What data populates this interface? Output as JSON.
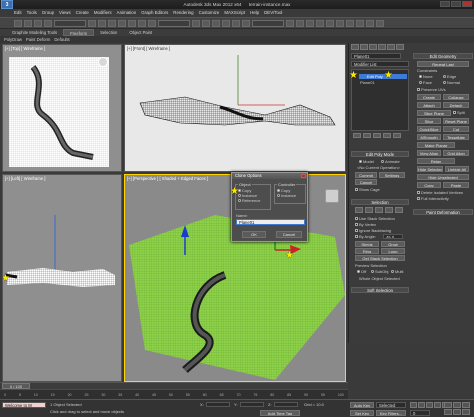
{
  "app": {
    "title": "Autodesk 3ds Max 2012 x64",
    "file": "terrain-instance.max",
    "logo_text": "3"
  },
  "menu": [
    "Edit",
    "Tools",
    "Group",
    "Views",
    "Create",
    "Modifiers",
    "Animation",
    "Graph Editors",
    "Rendering",
    "Customize",
    "MAXScript",
    "Help",
    "DEV/Tool"
  ],
  "ribbon": {
    "title_left": "Graphite Modeling Tools",
    "tabs": [
      "Freeform",
      "Selection",
      "Object Paint"
    ],
    "active_tab": "Freeform",
    "sub": [
      "PolyDraw",
      "Paint Deform",
      "Defaults"
    ]
  },
  "viewports": {
    "top": "[+] [Top] [ Wireframe ]",
    "front": "[+] [Front] [ Wireframe ]",
    "left": "[+] [Left] [ Wireframe ]",
    "perspective": "[+] [Perspective ] [ Shaded + Edged Faces ]"
  },
  "command_panel": {
    "object_name": "Plane01",
    "modifier_list": "Modifier List",
    "stack": [
      "Edit Poly",
      "Vertex",
      "Edge",
      "Border",
      "Polygon",
      "Element",
      "Plane01",
      "Edit Poly"
    ],
    "stack_selected": "Edit Poly",
    "rollouts": {
      "edit_poly_mode": "Edit Poly Mode",
      "model": "Model",
      "animate": "Animate",
      "no_current": "<No Current Operation>",
      "commit": "Commit",
      "settings": "Settings",
      "cancel": "Cancel",
      "show_cage": "Show Cage",
      "selection": "Selection",
      "use_stack": "Use Stack Selection",
      "by_vertex": "By Vertex",
      "ignore_backfacing": "Ignore Backfacing",
      "by_angle": "By Angle:",
      "angle_value": "45.0",
      "shrink": "Shrink",
      "grow": "Grow",
      "ring": "Ring",
      "loop": "Loop",
      "get_stack": "Get Stack Selection",
      "preview_selection": "Preview Selection",
      "off": "Off",
      "subobj": "SubObj",
      "multi": "Multi",
      "whole_object": "Whole Object Selected",
      "soft_selection": "Soft Selection"
    },
    "right_column": {
      "edit_geometry": "Edit Geometry",
      "repeat_last": "Repeat Last",
      "constraints": "Constraints",
      "none": "None",
      "edge": "Edge",
      "face": "Face",
      "normal": "Normal",
      "preserve_uvs": "Preserve UVs",
      "create": "Create",
      "collapse": "Collapse",
      "attach": "Attach",
      "detach": "Detach",
      "slice_plane": "Slice Plane",
      "split": "Split",
      "slice": "Slice",
      "reset_plane": "Reset Plane",
      "quickslice": "QuickSlice",
      "cut": "Cut",
      "msmooth": "MSmooth",
      "tessellate": "Tessellate",
      "make_planar": "Make Planar",
      "view_align": "View Align",
      "grid_align": "Grid Align",
      "relax": "Relax",
      "hide_selected": "Hide Selected",
      "unhide_all": "Unhide All",
      "hide_unselected": "Hide Unselected",
      "copy": "Copy",
      "paste": "Paste",
      "delete_isolated": "Delete Isolated Vertices",
      "full_interactivity": "Full Interactivity",
      "paint_deformation": "Paint Deformation"
    }
  },
  "dialog": {
    "title": "Clone Options",
    "object_label": "Object",
    "object_options": [
      "Copy",
      "Instance",
      "Reference"
    ],
    "object_selected": "Copy",
    "controller_label": "Controller",
    "controller_options": [
      "Copy",
      "Instance"
    ],
    "controller_selected": "Copy",
    "name_label": "Name:",
    "name_value": "Plane01",
    "ok": "OK",
    "cancel": "Cancel"
  },
  "timeline": {
    "slider_label": "0 / 100",
    "ticks": [
      "0",
      "5",
      "10",
      "15",
      "20",
      "25",
      "30",
      "35",
      "40",
      "45",
      "50",
      "55",
      "60",
      "65",
      "70",
      "75",
      "80",
      "85",
      "90",
      "95",
      "100"
    ]
  },
  "status": {
    "selected": "1 Object Selected",
    "prompt": "Click and drag to select and move objects",
    "welcome": "Welcome to M",
    "x_label": "X:",
    "y_label": "Y:",
    "z_label": "Z:",
    "grid": "Grid = 10.0",
    "auto_key": "Auto Key",
    "set_key": "Set Key",
    "selected_dd": "Selected",
    "key_filters": "Key Filters...",
    "add_time_tag": "Add Time Tag",
    "frame": "0"
  },
  "colors": {
    "accent": "#ffd400",
    "highlight": "#3d7bd6",
    "terrain": "#8fd24a",
    "star": "#ffe800"
  }
}
